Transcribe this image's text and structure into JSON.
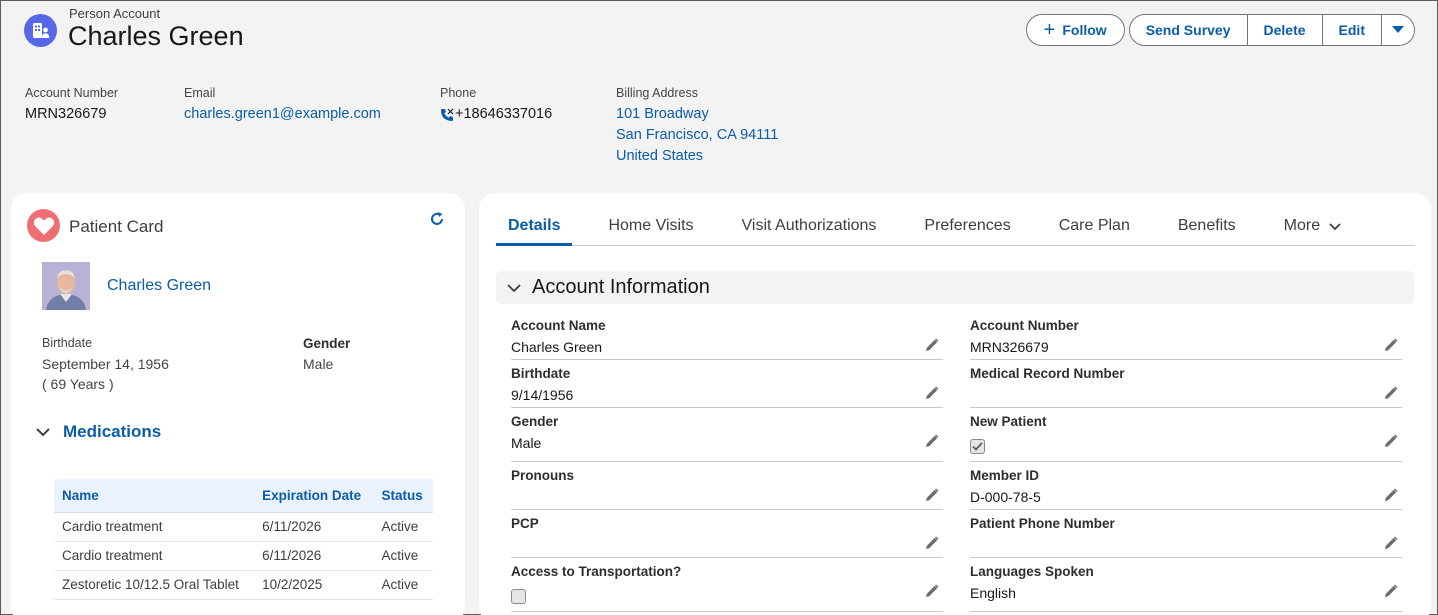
{
  "header": {
    "object_type": "Person Account",
    "record_name": "Charles Green",
    "buttons": {
      "follow": "Follow",
      "send_survey": "Send Survey",
      "delete": "Delete",
      "edit": "Edit"
    },
    "highlights": {
      "account_number_label": "Account Number",
      "account_number": "MRN326679",
      "email_label": "Email",
      "email": "charles.green1@example.com",
      "phone_label": "Phone",
      "phone": "+18646337016",
      "billing_label": "Billing Address",
      "billing_line1": "101 Broadway",
      "billing_line2": "San Francisco, CA 94111",
      "billing_line3": "United States"
    }
  },
  "patient_card": {
    "title": "Patient Card",
    "name": "Charles Green",
    "birthdate_label": "Birthdate",
    "birthdate": "September 14, 1956",
    "age": "( 69 Years )",
    "gender_label": "Gender",
    "gender": "Male",
    "medications_title": "Medications",
    "med_columns": [
      "Name",
      "Expiration Date",
      "Status"
    ],
    "medications": [
      {
        "name": "Cardio treatment",
        "expiration": "6/11/2026",
        "status": "Active"
      },
      {
        "name": "Cardio treatment",
        "expiration": "6/11/2026",
        "status": "Active"
      },
      {
        "name": "Zestoretic 10/12.5 Oral Tablet",
        "expiration": "10/2/2025",
        "status": "Active"
      }
    ]
  },
  "tabs": [
    "Details",
    "Home Visits",
    "Visit Authorizations",
    "Preferences",
    "Care Plan",
    "Benefits",
    "More"
  ],
  "details": {
    "section_title": "Account Information",
    "left_fields": [
      {
        "label": "Account Name",
        "value": "Charles Green"
      },
      {
        "label": "Birthdate",
        "value": "9/14/1956"
      },
      {
        "label": "Gender",
        "value": "Male"
      },
      {
        "label": "Pronouns",
        "value": ""
      },
      {
        "label": "PCP",
        "value": ""
      },
      {
        "label": "Access to Transportation?",
        "value": ""
      }
    ],
    "right_fields": [
      {
        "label": "Account Number",
        "value": "MRN326679"
      },
      {
        "label": "Medical Record Number",
        "value": ""
      },
      {
        "label": "New Patient",
        "value": ""
      },
      {
        "label": "Member ID",
        "value": "D-000-78-5"
      },
      {
        "label": "Patient Phone Number",
        "value": ""
      },
      {
        "label": "Languages Spoken",
        "value": "English"
      }
    ],
    "new_patient_checked": true,
    "transportation_checked": false
  },
  "colors": {
    "brand_blue": "#0b5cab",
    "account_icon": "#5867e8",
    "heart_icon": "#f06e73"
  }
}
